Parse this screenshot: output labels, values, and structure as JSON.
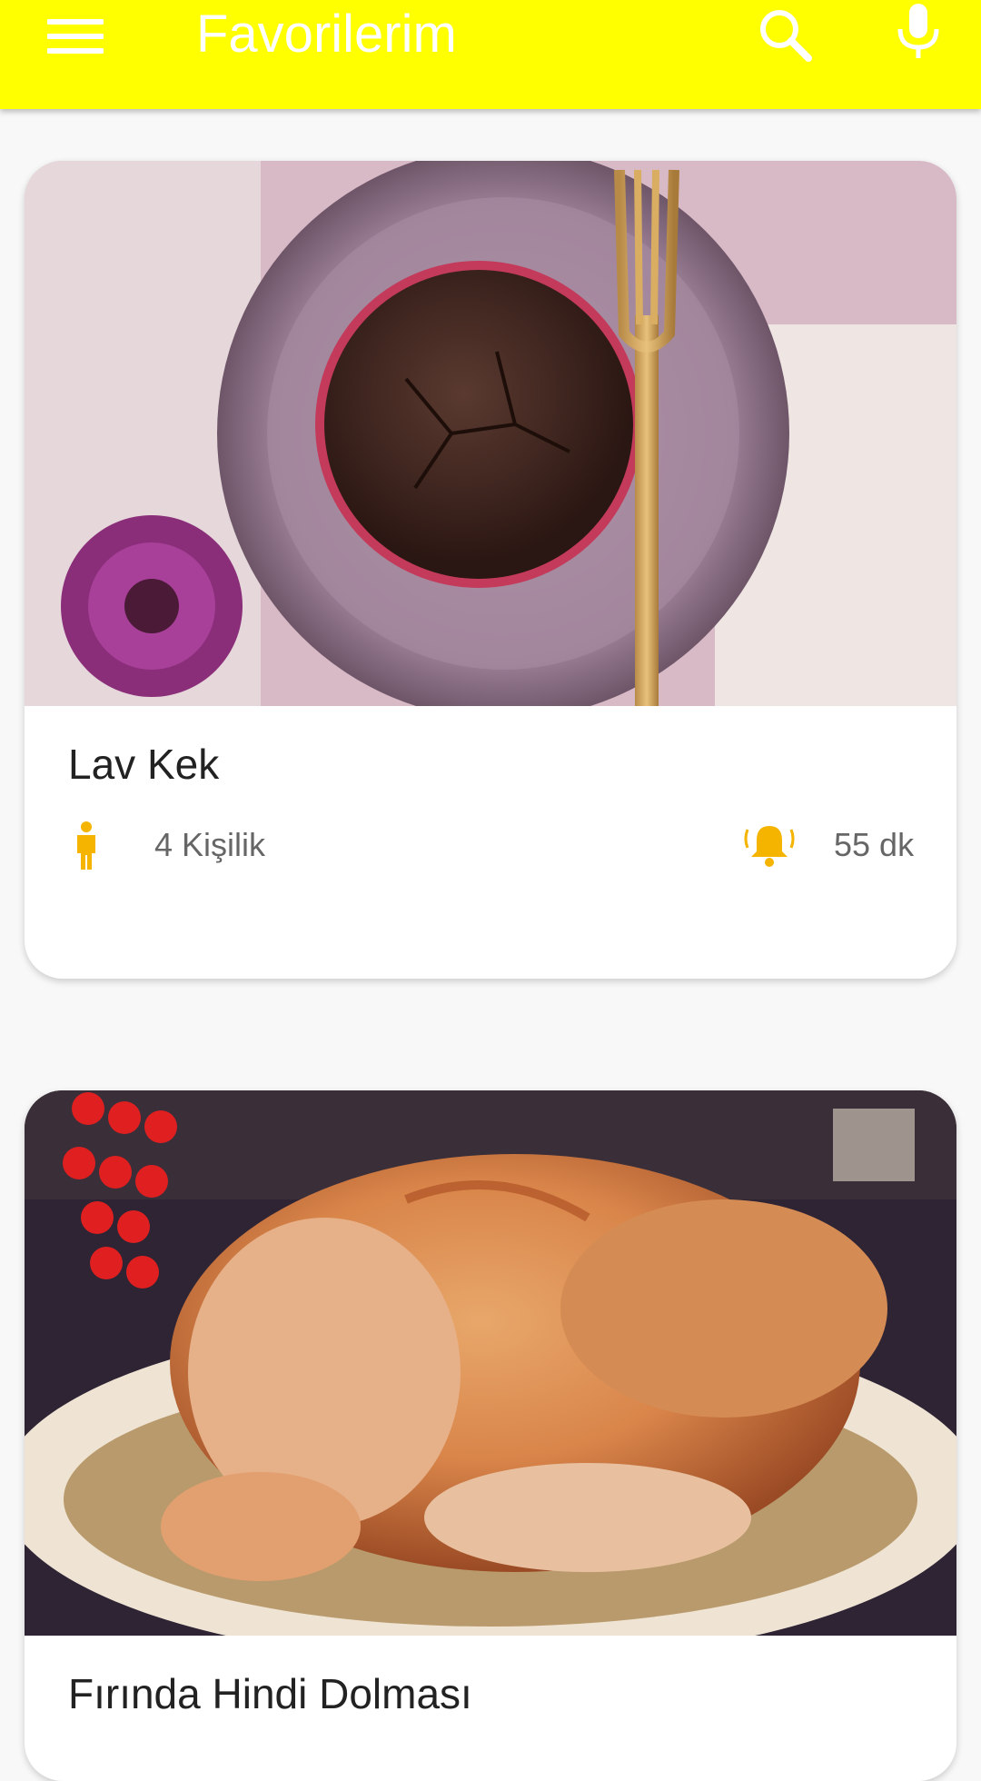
{
  "app_bar": {
    "title": "Favorilerim",
    "menu_icon": "hamburger-menu-icon",
    "search_icon": "search-icon",
    "mic_icon": "microphone-icon",
    "background_color": "#ffff00",
    "foreground_color": "#ffffff"
  },
  "recipes": [
    {
      "title": "Lav Kek",
      "servings": "4 Kişilik",
      "time": "55 dk",
      "servings_icon": "person-icon",
      "time_icon": "alarm-bell-icon",
      "image": "chocolate-lava-cake-photo"
    },
    {
      "title": "Fırında Hindi Dolması",
      "image": "roast-stuffed-turkey-photo"
    }
  ],
  "accent_color": "#f4b400"
}
